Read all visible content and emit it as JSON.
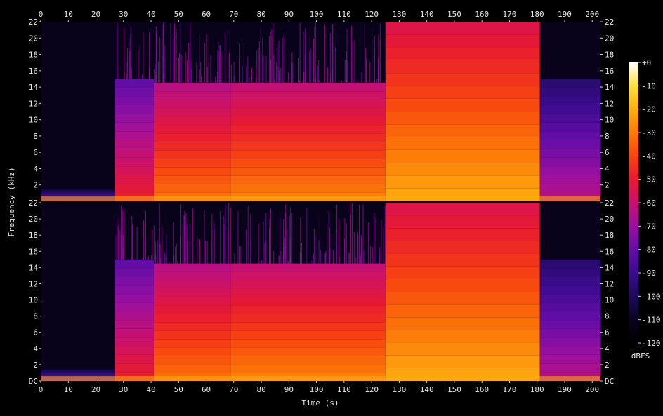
{
  "chart_data": {
    "type": "heatmap",
    "subtype": "spectrogram",
    "channels": 2,
    "xlabel": "Time (s)",
    "ylabel": "Frequency (kHz)",
    "xlim": [
      0,
      203
    ],
    "ylim_khz": [
      0,
      22
    ],
    "x_ticks": [
      "0",
      "10",
      "20",
      "30",
      "40",
      "50",
      "60",
      "70",
      "80",
      "90",
      "100",
      "110",
      "120",
      "130",
      "140",
      "150",
      "160",
      "170",
      "180",
      "190",
      "200"
    ],
    "y_ticks_top": [
      "22",
      "20",
      "18",
      "16",
      "14",
      "12",
      "10",
      "8",
      "6",
      "4",
      "2"
    ],
    "y_ticks_bottom": [
      "22",
      "20",
      "18",
      "16",
      "14",
      "12",
      "10",
      "8",
      "6",
      "4",
      "2",
      "DC"
    ],
    "colorbar": {
      "label": "dBFS",
      "ticks": [
        "+0",
        "-10",
        "-20",
        "-30",
        "-40",
        "-50",
        "-60",
        "-70",
        "-80",
        "-90",
        "-100",
        "-110",
        "-120"
      ],
      "range_db": [
        -120,
        0
      ],
      "colors": [
        "#000000",
        "#0a0320",
        "#1e0a5a",
        "#3a0c8c",
        "#640da8",
        "#9a10a0",
        "#c81070",
        "#e81a30",
        "#f84510",
        "#fc7a08",
        "#ffb010",
        "#ffe040",
        "#ffffff"
      ]
    },
    "segments": [
      {
        "start_s": 0,
        "end_s": 27,
        "bandwidth_khz": 1.5,
        "level_db": -100
      },
      {
        "start_s": 27,
        "end_s": 41,
        "bandwidth_khz": 15,
        "level_db": -75
      },
      {
        "start_s": 41,
        "end_s": 69,
        "bandwidth_khz": 14.5,
        "level_db": -58
      },
      {
        "start_s": 69,
        "end_s": 125,
        "bandwidth_khz": 14.5,
        "level_db": -55
      },
      {
        "start_s": 125,
        "end_s": 181,
        "bandwidth_khz": 22,
        "level_db": -48
      },
      {
        "start_s": 181,
        "end_s": 203,
        "bandwidth_khz": 15,
        "level_db": -90
      }
    ]
  }
}
